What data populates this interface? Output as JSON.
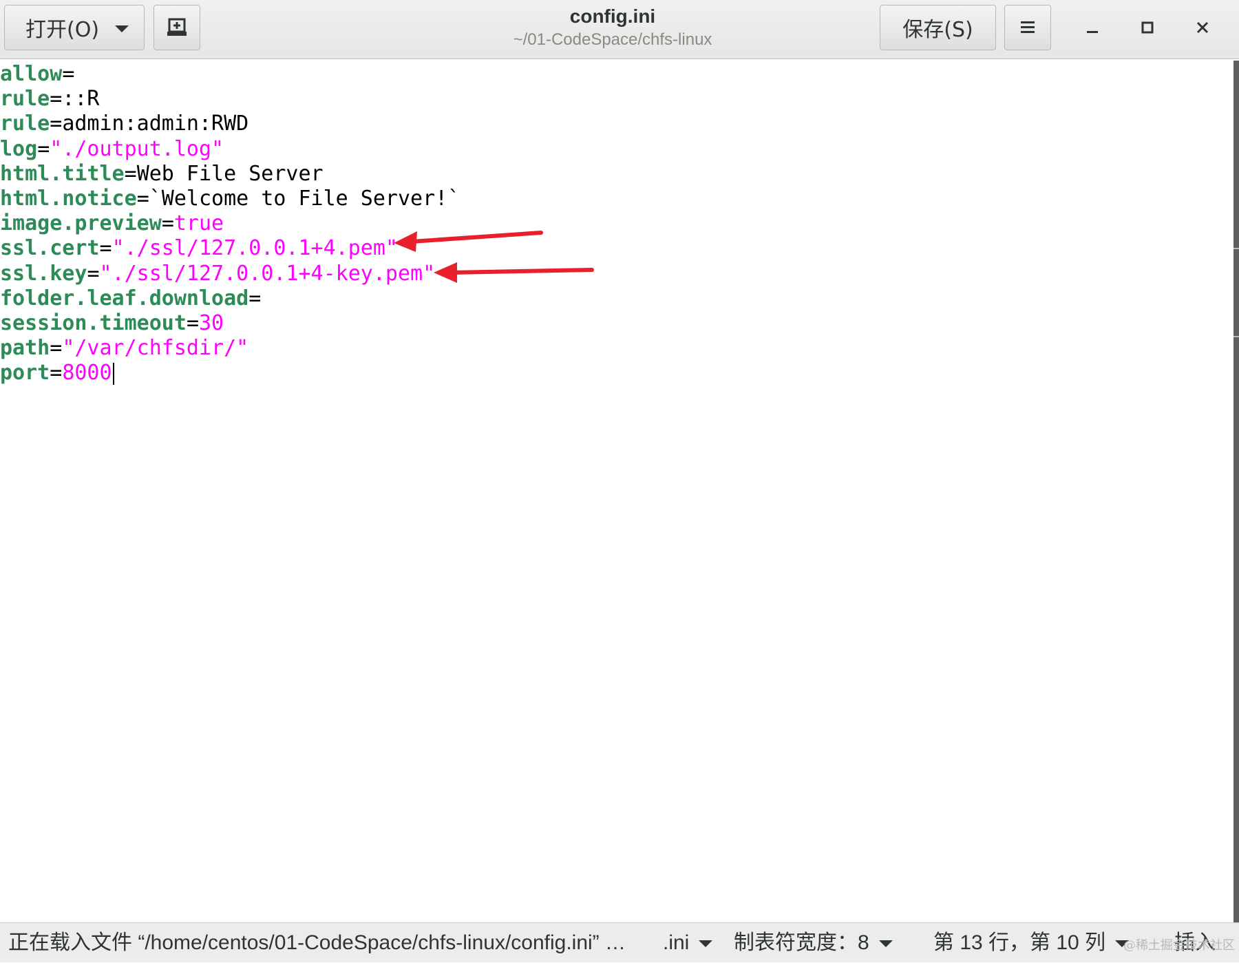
{
  "window": {
    "title": "config.ini",
    "subtitle": "~/01-CodeSpace/chfs-linux"
  },
  "toolbar": {
    "open_label": "打开(O)",
    "new_icon": "new-document-icon",
    "save_label": "保存(S)",
    "menu_icon": "hamburger-menu-icon",
    "minimize_icon": "minimize-icon",
    "maximize_icon": "maximize-icon",
    "close_icon": "close-icon"
  },
  "editor": {
    "lines": [
      {
        "key": "allow",
        "eq": "=",
        "value": "",
        "value_type": "plain"
      },
      {
        "key": "rule",
        "eq": "=",
        "value": "::R",
        "value_type": "plain"
      },
      {
        "key": "rule",
        "eq": "=",
        "value": "admin:admin:RWD",
        "value_type": "plain"
      },
      {
        "key": "log",
        "eq": "=",
        "value": "\"./output.log\"",
        "value_type": "string"
      },
      {
        "key": "html.title",
        "eq": "=",
        "value": "Web File Server",
        "value_type": "plain"
      },
      {
        "key": "html.notice",
        "eq": "=",
        "value": "`Welcome to File Server!`",
        "value_type": "plain"
      },
      {
        "key": "image.preview",
        "eq": "=",
        "value": "true",
        "value_type": "string"
      },
      {
        "key": "ssl.cert",
        "eq": "=",
        "value": "\"./ssl/127.0.0.1+4.pem\"",
        "value_type": "string"
      },
      {
        "key": "ssl.key",
        "eq": "=",
        "value": "\"./ssl/127.0.0.1+4-key.pem\"",
        "value_type": "string"
      },
      {
        "key": "folder.leaf.download",
        "eq": "=",
        "value": "",
        "value_type": "plain"
      },
      {
        "key": "session.timeout",
        "eq": "=",
        "value": "30",
        "value_type": "string"
      },
      {
        "key": "path",
        "eq": "=",
        "value": "\"/var/chfsdir/\"",
        "value_type": "string"
      },
      {
        "key": "port",
        "eq": "=",
        "value": "8000",
        "value_type": "string"
      }
    ],
    "colors": {
      "key": "#2e8b57",
      "string": "#ff00ff",
      "plain": "#000000",
      "annotation_arrow": "#e8202a"
    }
  },
  "statusbar": {
    "loading_text": "正在载入文件 “/home/centos/01-CodeSpace/chfs-linux/config.ini” …",
    "language": ".ini",
    "tab_width": "制表符宽度：8",
    "position": "第 13 行，第 10 列",
    "mode": "插入",
    "watermark": "@稀土掘金技术社区"
  }
}
